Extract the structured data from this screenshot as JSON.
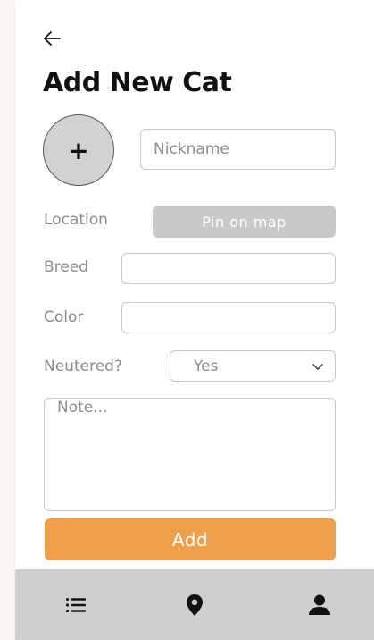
{
  "header": {
    "back_icon": "arrow-left-icon",
    "title": "Add New Cat"
  },
  "photo": {
    "label": "+",
    "icon": "plus-icon"
  },
  "form": {
    "nickname": {
      "placeholder": "Nickname",
      "value": ""
    },
    "location": {
      "label": "Location",
      "button_label": "Pin on map"
    },
    "breed": {
      "label": "Breed",
      "value": ""
    },
    "color": {
      "label": "Color",
      "value": ""
    },
    "neutered": {
      "label": "Neutered?",
      "selected": "Yes",
      "icon": "chevron-down-icon"
    },
    "note": {
      "placeholder": "Note...",
      "value": ""
    },
    "submit_label": "Add"
  },
  "bottom_nav": {
    "items": [
      {
        "icon": "list-icon"
      },
      {
        "icon": "map-pin-icon"
      },
      {
        "icon": "user-icon"
      }
    ]
  },
  "colors": {
    "accent": "#f0a04b",
    "disabled_button": "#c9c9c9",
    "nav_background": "#cfcfcf"
  }
}
